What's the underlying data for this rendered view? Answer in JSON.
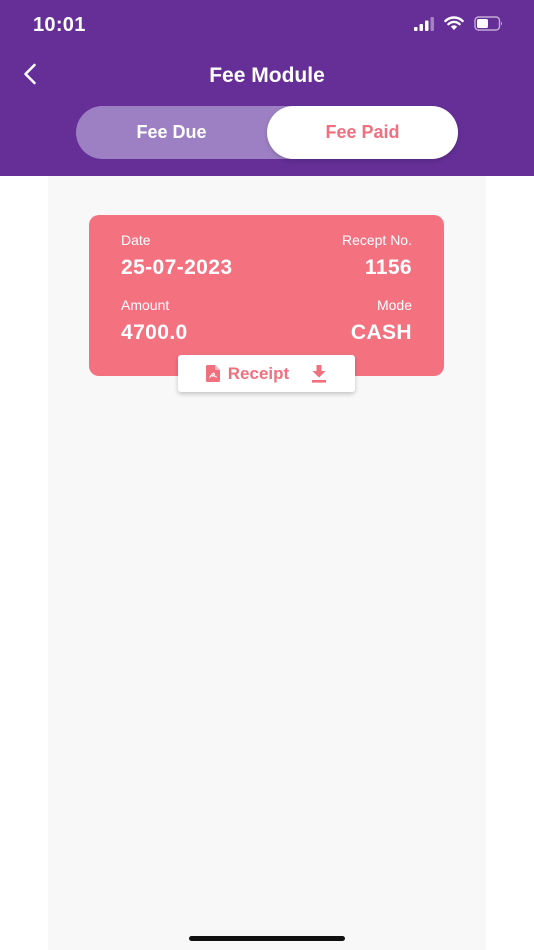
{
  "status": {
    "time": "10:01"
  },
  "header": {
    "title": "Fee Module",
    "tabs": [
      {
        "label": "Fee Due",
        "active": false
      },
      {
        "label": "Fee Paid",
        "active": true
      }
    ]
  },
  "card": {
    "date_label": "Date",
    "date_value": "25-07-2023",
    "receipt_no_label": "Recept No.",
    "receipt_no_value": "1156",
    "amount_label": "Amount",
    "amount_value": "4700.0",
    "mode_label": "Mode",
    "mode_value": "CASH",
    "receipt_button_label": "Receipt"
  },
  "colors": {
    "header_bg": "#652f97",
    "card_bg": "#f47280",
    "accent_text": "#f07080"
  },
  "icons": {
    "back": "back-arrow-icon",
    "pdf": "pdf-file-icon",
    "download": "download-icon",
    "signal": "signal-icon",
    "wifi": "wifi-icon",
    "battery": "battery-icon"
  }
}
